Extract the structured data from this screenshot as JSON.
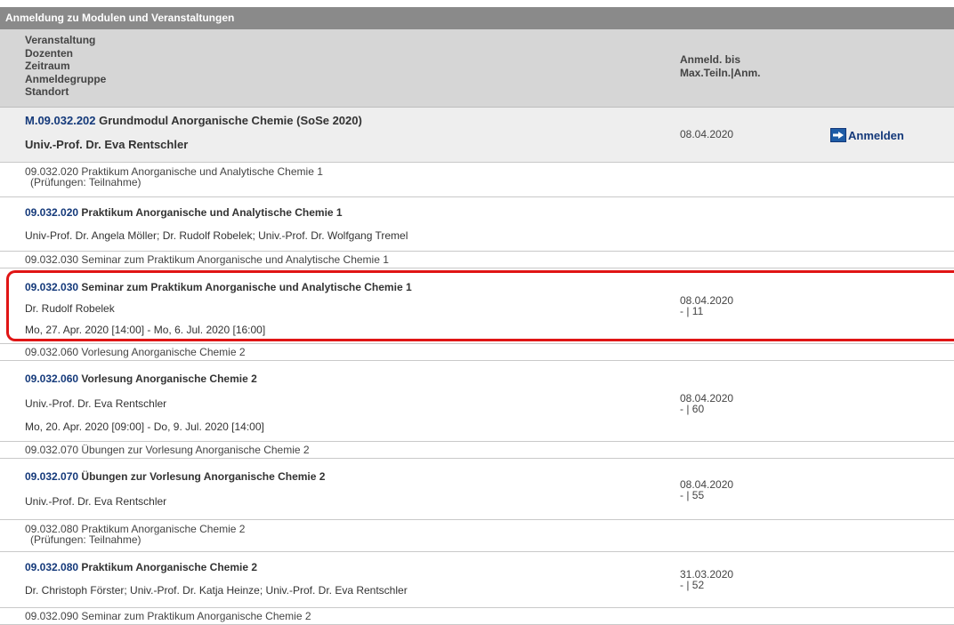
{
  "title": "Anmeldung zu Modulen und Veranstaltungen",
  "header": {
    "col1": [
      "Veranstaltung",
      "Dozenten",
      "Zeitraum",
      "Anmeldegruppe",
      "Standort"
    ],
    "col2": [
      "Anmeld. bis",
      "Max.Teiln.|Anm."
    ]
  },
  "module": {
    "code": "M.09.032.202",
    "name": "Grundmodul Anorganische Chemie (SoSe 2020)",
    "lecturer": "Univ.-Prof. Dr. Eva Rentschler",
    "deadline": "08.04.2020",
    "action": "Anmelden"
  },
  "rows": [
    {
      "line1": "09.032.020 Praktikum Anorganische und Analytische Chemie 1",
      "line2": "(Prüfungen: Teilnahme)"
    },
    {
      "code": "09.032.020",
      "title": "Praktikum Anorganische und Analytische Chemie 1",
      "lecturers": "Univ-Prof. Dr. Angela Möller; Dr. Rudolf Robelek; Univ.-Prof. Dr. Wolfgang Tremel"
    },
    {
      "line1": "09.032.030 Seminar zum Praktikum Anorganische und Analytische Chemie 1"
    },
    {
      "code": "09.032.030",
      "title": "Seminar zum Praktikum Anorganische und Analytische Chemie 1",
      "lecturers": "Dr. Rudolf Robelek",
      "period": "Mo, 27. Apr. 2020 [14:00] - Mo, 6. Jul. 2020 [16:00]",
      "deadline": "08.04.2020",
      "capacity": "- | 11"
    },
    {
      "line1": "09.032.060 Vorlesung Anorganische Chemie 2"
    },
    {
      "code": "09.032.060",
      "title": "Vorlesung Anorganische Chemie 2",
      "lecturers": "Univ.-Prof. Dr. Eva Rentschler",
      "period": "Mo, 20. Apr. 2020 [09:00] - Do, 9. Jul. 2020 [14:00]",
      "deadline": "08.04.2020",
      "capacity": "- | 60"
    },
    {
      "line1": "09.032.070 Übungen zur Vorlesung Anorganische Chemie 2"
    },
    {
      "code": "09.032.070",
      "title": "Übungen zur Vorlesung Anorganische Chemie 2",
      "lecturers": "Univ.-Prof. Dr. Eva Rentschler",
      "deadline": "08.04.2020",
      "capacity": "- | 55"
    },
    {
      "line1": "09.032.080 Praktikum Anorganische Chemie 2",
      "line2": "(Prüfungen: Teilnahme)"
    },
    {
      "code": "09.032.080",
      "title": "Praktikum Anorganische Chemie 2",
      "lecturers": "Dr. Christoph Förster; Univ.-Prof. Dr. Katja Heinze; Univ.-Prof. Dr. Eva Rentschler",
      "deadline": "31.03.2020",
      "capacity": "- | 52"
    },
    {
      "line1": "09.032.090 Seminar zum Praktikum Anorganische Chemie 2"
    }
  ]
}
